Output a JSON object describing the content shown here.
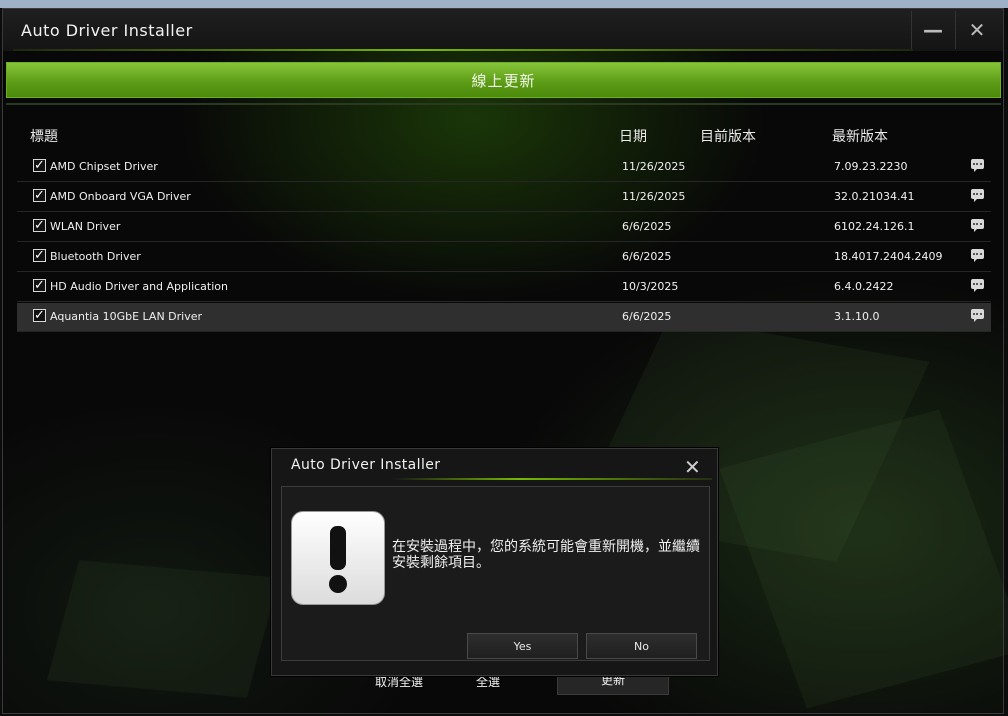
{
  "window": {
    "title": "Auto Driver Installer",
    "minimize_icon": "minimize-icon",
    "close_icon": "close-icon"
  },
  "online_update_label": "線上更新",
  "columns": {
    "title": "標題",
    "date": "日期",
    "current_version": "目前版本",
    "latest_version": "最新版本"
  },
  "drivers": [
    {
      "checked": true,
      "name": "AMD Chipset Driver",
      "date": "11/26/2025",
      "current": "",
      "latest": "7.09.23.2230"
    },
    {
      "checked": true,
      "name": "AMD Onboard VGA Driver",
      "date": "11/26/2025",
      "current": "",
      "latest": "32.0.21034.41"
    },
    {
      "checked": true,
      "name": "WLAN Driver",
      "date": "6/6/2025",
      "current": "",
      "latest": "6102.24.126.1"
    },
    {
      "checked": true,
      "name": "Bluetooth Driver",
      "date": "6/6/2025",
      "current": "",
      "latest": "18.4017.2404.2409"
    },
    {
      "checked": true,
      "name": "HD Audio Driver and Application",
      "date": "10/3/2025",
      "current": "",
      "latest": "6.4.0.2422"
    },
    {
      "checked": true,
      "name": "Aquantia 10GbE LAN Driver",
      "date": "6/6/2025",
      "current": "",
      "latest": "3.1.10.0"
    }
  ],
  "bottom": {
    "deselect_all": "取消全選",
    "select_all": "全選",
    "update": "更新"
  },
  "dialog": {
    "title": "Auto Driver Installer",
    "message": "在安裝過程中，您的系統可能會重新開機，並繼續安裝剩餘項目。",
    "yes": "Yes",
    "no": "No",
    "icon": "warning-icon"
  },
  "colors": {
    "accent": "#76b900",
    "update_bar": "#5a9a14"
  }
}
